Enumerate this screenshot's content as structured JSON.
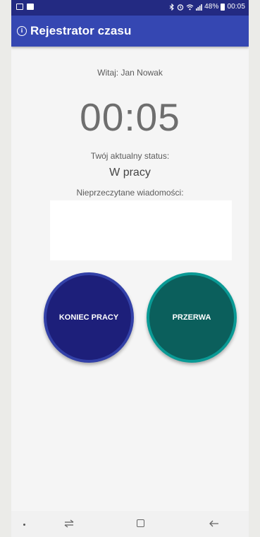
{
  "status_bar": {
    "battery": "48%",
    "time": "00:05",
    "icons": [
      "image-icon",
      "facebook-icon",
      "bluetooth-icon",
      "alarm-icon",
      "wifi-icon",
      "signal-icon",
      "battery-icon"
    ]
  },
  "app_bar": {
    "title": "Rejestrator czasu",
    "icon": "info-icon"
  },
  "main": {
    "greeting": "Witaj: Jan Nowak",
    "timer": "00:05",
    "status_label": "Twój aktualny status:",
    "status_value": "W pracy",
    "messages_label": "Nieprzeczytane wiadomości:",
    "messages_value": ""
  },
  "buttons": {
    "end_work_label": "KONIEC PRACY",
    "break_label": "PRZERWA"
  },
  "colors": {
    "status_bar": "#232a82",
    "app_bar": "#3547b2",
    "end_button": "#1d1f7a",
    "end_button_ring": "#3341a8",
    "break_button": "#0b5f5c",
    "break_button_ring": "#0a9a95"
  },
  "nav_bar": {
    "icons": [
      "dot-icon",
      "recent-apps-icon",
      "home-icon",
      "back-icon"
    ]
  }
}
